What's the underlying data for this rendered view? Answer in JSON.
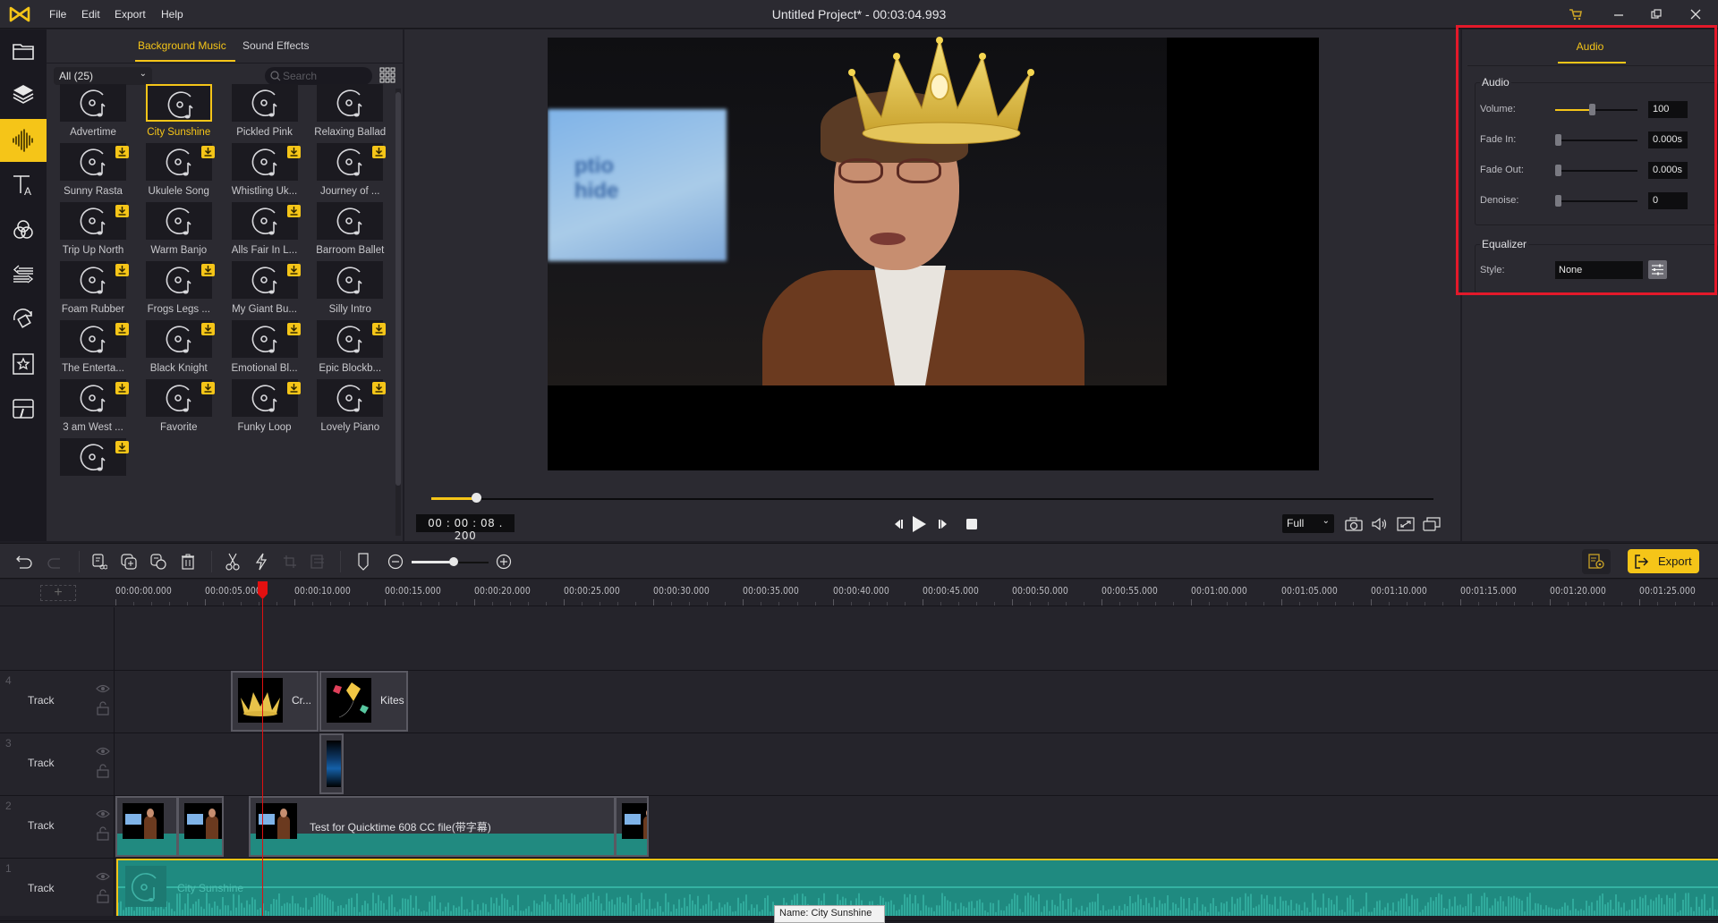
{
  "app": {
    "title": "Untitled Project* - 00:03:04.993",
    "menu": [
      "File",
      "Edit",
      "Export",
      "Help"
    ],
    "window_controls": [
      "cart-icon",
      "minimize-icon",
      "restore-icon",
      "close-icon"
    ]
  },
  "rail": {
    "items": [
      {
        "name": "media",
        "icon": "folder-icon",
        "active": false
      },
      {
        "name": "layers",
        "icon": "layers-icon",
        "active": false
      },
      {
        "name": "audio",
        "icon": "audio-wave-icon",
        "active": true
      },
      {
        "name": "text",
        "icon": "text-icon",
        "active": false
      },
      {
        "name": "filters",
        "icon": "filters-icon",
        "active": false
      },
      {
        "name": "transitions",
        "icon": "transitions-icon",
        "active": false
      },
      {
        "name": "motions",
        "icon": "rotate-icon",
        "active": false
      },
      {
        "name": "stickers",
        "icon": "star-icon",
        "active": false
      },
      {
        "name": "templates",
        "icon": "template-icon",
        "active": false
      }
    ]
  },
  "media": {
    "tabs": [
      "Background Music",
      "Sound Effects"
    ],
    "active_tab": "Background Music",
    "filter": "All (25)",
    "search_placeholder": "Search",
    "items": [
      {
        "label": "Advertime",
        "download": false,
        "selected": false
      },
      {
        "label": "City Sunshine",
        "download": false,
        "selected": true
      },
      {
        "label": "Pickled Pink",
        "download": false,
        "selected": false
      },
      {
        "label": "Relaxing Ballad",
        "download": false,
        "selected": false
      },
      {
        "label": "Sunny Rasta",
        "download": true,
        "selected": false
      },
      {
        "label": "Ukulele Song",
        "download": true,
        "selected": false
      },
      {
        "label": "Whistling Uk...",
        "download": true,
        "selected": false
      },
      {
        "label": "Journey of ...",
        "download": true,
        "selected": false
      },
      {
        "label": "Trip Up North",
        "download": true,
        "selected": false
      },
      {
        "label": "Warm Banjo",
        "download": false,
        "selected": false
      },
      {
        "label": "Alls Fair In L...",
        "download": true,
        "selected": false
      },
      {
        "label": "Barroom Ballet",
        "download": false,
        "selected": false
      },
      {
        "label": "Foam Rubber",
        "download": true,
        "selected": false
      },
      {
        "label": "Frogs Legs ...",
        "download": true,
        "selected": false
      },
      {
        "label": "My Giant Bu...",
        "download": true,
        "selected": false
      },
      {
        "label": "Silly Intro",
        "download": false,
        "selected": false
      },
      {
        "label": "The Enterta...",
        "download": true,
        "selected": false
      },
      {
        "label": "Black Knight",
        "download": true,
        "selected": false
      },
      {
        "label": "Emotional Bl...",
        "download": true,
        "selected": false
      },
      {
        "label": "Epic Blockb...",
        "download": true,
        "selected": false
      },
      {
        "label": "3 am West ...",
        "download": true,
        "selected": false
      },
      {
        "label": "Favorite",
        "download": true,
        "selected": false
      },
      {
        "label": "Funky Loop",
        "download": true,
        "selected": false
      },
      {
        "label": "Lovely Piano",
        "download": true,
        "selected": false
      },
      {
        "label": "",
        "download": true,
        "selected": false
      }
    ]
  },
  "preview": {
    "timecode": "00 : 00 : 08 . 200",
    "progress_fraction": 0.045,
    "quality": "Full",
    "controls": [
      "prev-frame",
      "play",
      "next-frame",
      "stop"
    ],
    "tools": [
      "snapshot-icon",
      "volume-icon",
      "fullscreen-icon",
      "detach-icon"
    ]
  },
  "properties": {
    "tab": "Audio",
    "audio_group": "Audio",
    "volume": {
      "label": "Volume:",
      "value": "100",
      "fraction": 0.45
    },
    "fade_in": {
      "label": "Fade In:",
      "value": "0.000s",
      "fraction": 0
    },
    "fade_out": {
      "label": "Fade Out:",
      "value": "0.000s",
      "fraction": 0
    },
    "denoise": {
      "label": "Denoise:",
      "value": "0",
      "fraction": 0
    },
    "equalizer_group": "Equalizer",
    "style": {
      "label": "Style:",
      "value": "None"
    }
  },
  "toolbar": {
    "export_label": "Export",
    "zoom_fraction": 0.55
  },
  "timeline": {
    "ruler_labels": [
      "00:00:00.000",
      "00:00:05.000",
      "00:00:10.000",
      "00:00:15.000",
      "00:00:20.000",
      "00:00:25.000",
      "00:00:30.000",
      "00:00:35.000",
      "00:00:40.000",
      "00:00:45.000",
      "00:00:50.000",
      "00:00:55.000",
      "00:01:00.000",
      "00:01:05.000",
      "00:01:10.000",
      "00:01:15.000",
      "00:01:20.000",
      "00:01:25.000"
    ],
    "tracks": [
      {
        "number": "4",
        "label": "Track"
      },
      {
        "number": "3",
        "label": "Track"
      },
      {
        "number": "2",
        "label": "Track"
      },
      {
        "number": "1",
        "label": "Track"
      }
    ],
    "clips": {
      "crown": "Cr...",
      "kites": "Kites",
      "video_main": "Test for Quicktime 608 CC file(带字幕)",
      "audio": "City Sunshine"
    },
    "tooltip": "Name: City Sunshine"
  }
}
